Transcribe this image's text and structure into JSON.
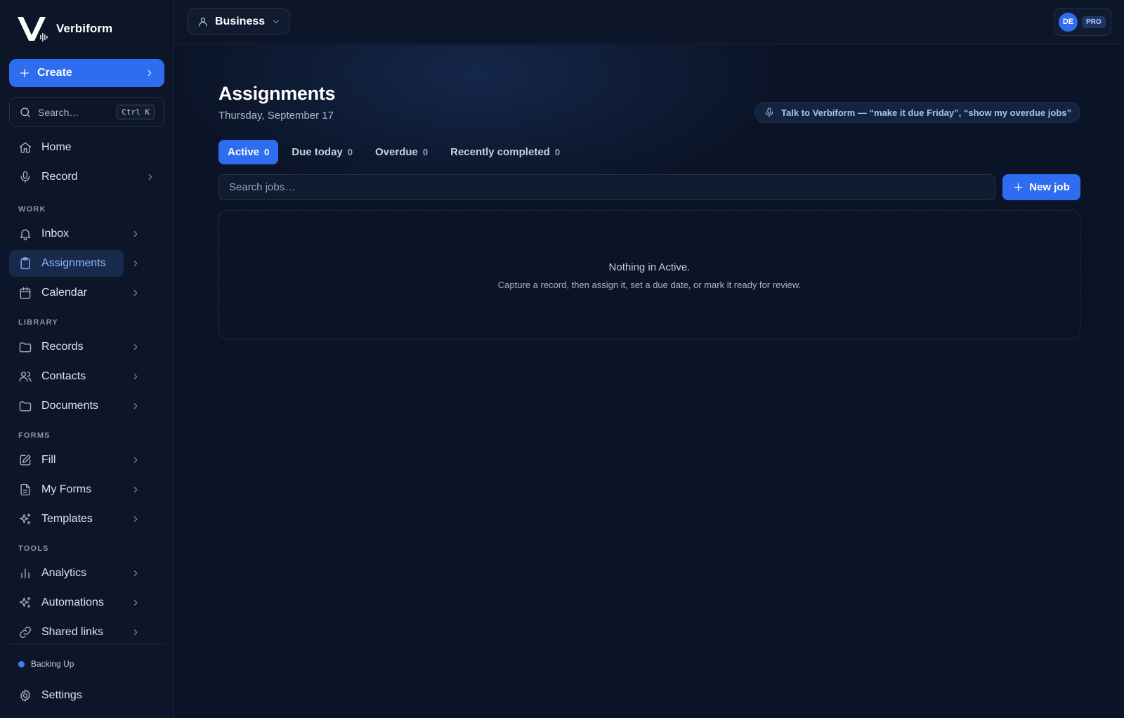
{
  "app": {
    "name": "Verbiform"
  },
  "sidebar": {
    "create_label": "Create",
    "search": {
      "placeholder": "Search…",
      "shortcut": "Ctrl K"
    },
    "top_items": [
      {
        "label": "Home",
        "icon": "home-icon"
      },
      {
        "label": "Record",
        "icon": "microphone-icon"
      }
    ],
    "sections": [
      {
        "label": "WORK",
        "items": [
          {
            "label": "Inbox",
            "icon": "bell-icon"
          },
          {
            "label": "Assignments",
            "icon": "clipboard-icon",
            "active": true
          },
          {
            "label": "Calendar",
            "icon": "calendar-icon"
          }
        ]
      },
      {
        "label": "LIBRARY",
        "items": [
          {
            "label": "Records",
            "icon": "folder-icon"
          },
          {
            "label": "Contacts",
            "icon": "users-icon"
          },
          {
            "label": "Documents",
            "icon": "folder-icon"
          }
        ]
      },
      {
        "label": "FORMS",
        "items": [
          {
            "label": "Fill",
            "icon": "pen-square-icon"
          },
          {
            "label": "My Forms",
            "icon": "file-text-icon"
          },
          {
            "label": "Templates",
            "icon": "sparkles-icon"
          }
        ]
      },
      {
        "label": "TOOLS",
        "items": [
          {
            "label": "Analytics",
            "icon": "bar-chart-icon"
          },
          {
            "label": "Automations",
            "icon": "sparkles-icon"
          },
          {
            "label": "Shared links",
            "icon": "link-icon"
          }
        ]
      }
    ],
    "status": {
      "text": "Backing Up",
      "color": "#3b82f6"
    },
    "settings_label": "Settings"
  },
  "topbar": {
    "workspace": "Business",
    "avatar_initials": "DE",
    "plan_badge": "PRO"
  },
  "main": {
    "title": "Assignments",
    "date": "Thursday, September 17",
    "voice_hint": "Talk to Verbiform — “make it due Friday”, “show my overdue jobs”",
    "tabs": [
      {
        "label": "Active",
        "count": "0",
        "active": true
      },
      {
        "label": "Due today",
        "count": "0"
      },
      {
        "label": "Overdue",
        "count": "0"
      },
      {
        "label": "Recently completed",
        "count": "0"
      }
    ],
    "search_placeholder": "Search jobs…",
    "new_job_label": "New job",
    "empty": {
      "title": "Nothing in Active.",
      "subtitle": "Capture a record, then assign it, set a due date, or mark it ready for review."
    }
  },
  "colors": {
    "accent": "#2f6df0",
    "background": "#0b1427",
    "sidebar": "#0c1628",
    "active_text": "#8fb6ff"
  }
}
